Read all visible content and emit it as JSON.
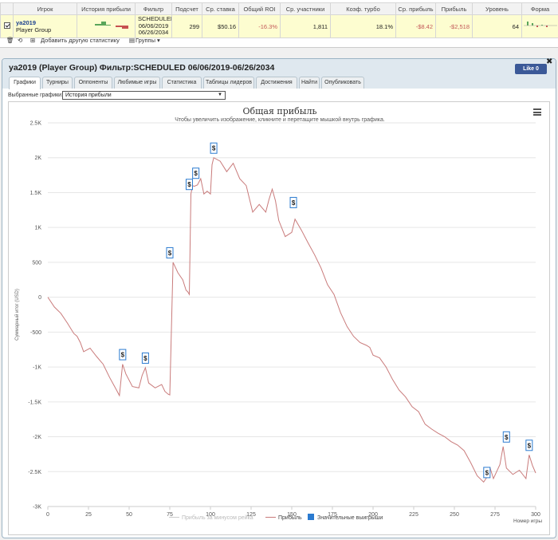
{
  "stats_table": {
    "headers": [
      "Игрок",
      "История прибыли",
      "Фильтр",
      "Подсчет",
      "Ср. ставка",
      "Общий ROI",
      "Ср. участники",
      "Коэф. турбо",
      "Ср. прибыль",
      "Прибыль",
      "Уровень",
      "Форма"
    ],
    "row": {
      "player_name": "ya2019",
      "player_group": "Player Group",
      "filter_lines": [
        "SCHEDULED",
        "06/06/2019",
        "06/26/2034"
      ],
      "count": "299",
      "avg_stake": "$50.16",
      "roi": "-16.3%",
      "avg_entrants": "1,811",
      "turbo": "18.1%",
      "avg_profit": "-$8.42",
      "profit": "-$2,518",
      "level": "64"
    }
  },
  "toolbar": {
    "add_stat": "Добавить другую статистику",
    "groups": "Группы"
  },
  "panel": {
    "title": "ya2019 (Player Group) Фильтр:SCHEDULED 06/06/2019-06/26/2034",
    "fb_like": "Like 0",
    "tabs": [
      "Графики",
      "Турниры",
      "Оппоненты",
      "Любимые игры",
      "Статистика",
      "Таблицы лидеров",
      "Достижения",
      "Найти",
      "Опубликовать"
    ],
    "chart_select_label": "Выбранные графики:",
    "chart_select_value": "История прибыли"
  },
  "chart_data": {
    "type": "line",
    "title": "Общая прибыль",
    "subtitle": "Чтобы увеличить изображение, кликните и перетащите мышкой внутрь графика.",
    "xlabel": "Номер игры",
    "ylabel": "Суммарный итог (USD)",
    "xlim": [
      0,
      300
    ],
    "ylim": [
      -3000,
      2500
    ],
    "x_ticks": [
      0,
      25,
      50,
      75,
      100,
      125,
      150,
      175,
      200,
      225,
      250,
      275,
      300
    ],
    "y_ticks": [
      2500,
      2000,
      1500,
      1000,
      500,
      0,
      -500,
      -1000,
      -1500,
      -2000,
      -2500,
      -3000
    ],
    "y_tick_labels": [
      "2.5K",
      "2K",
      "1.5K",
      "1K",
      "500",
      "0",
      "-500",
      "-1K",
      "-1.5K",
      "-2K",
      "-2.5K",
      "-3K"
    ],
    "x_tick_labels": [
      "0",
      "25",
      "50",
      "75",
      "100",
      "125",
      "150",
      "175",
      "200",
      "225",
      "250",
      "275",
      "300"
    ],
    "grid": true,
    "legend_position": "bottom",
    "colors": {
      "profit": "#c97b7b",
      "rake": "#cccccc",
      "wins": "#2b7bd0"
    },
    "series": [
      {
        "name": "Прибыль за минусом рейка",
        "color": "#cccccc",
        "x": [],
        "y": []
      },
      {
        "name": "Прибыль",
        "color": "#c97b7b",
        "x": [
          0,
          4,
          8,
          12,
          16,
          18,
          20,
          22,
          26,
          30,
          34,
          38,
          42,
          44,
          46,
          48,
          52,
          56,
          58,
          60,
          62,
          66,
          70,
          72,
          74,
          75,
          77,
          80,
          83,
          85,
          86,
          87,
          88,
          89,
          90,
          92,
          94,
          96,
          98,
          100,
          101,
          102,
          106,
          110,
          114,
          118,
          122,
          126,
          130,
          134,
          136,
          138,
          140,
          142,
          146,
          150,
          152,
          156,
          160,
          164,
          168,
          172,
          176,
          180,
          184,
          188,
          192,
          196,
          198,
          200,
          204,
          208,
          212,
          216,
          220,
          224,
          228,
          232,
          236,
          240,
          244,
          248,
          252,
          256,
          260,
          264,
          268,
          270,
          272,
          274,
          276,
          278,
          280,
          282,
          286,
          290,
          294,
          296,
          298,
          300
        ],
        "y": [
          0,
          -140,
          -230,
          -370,
          -520,
          -560,
          -650,
          -780,
          -730,
          -850,
          -960,
          -1150,
          -1320,
          -1410,
          -960,
          -1100,
          -1280,
          -1300,
          -1120,
          -1010,
          -1230,
          -1300,
          -1250,
          -1350,
          -1390,
          -1400,
          500,
          350,
          250,
          100,
          80,
          40,
          1480,
          1600,
          1590,
          1610,
          1700,
          1480,
          1520,
          1480,
          1900,
          2000,
          1950,
          1800,
          1920,
          1700,
          1600,
          1220,
          1330,
          1220,
          1400,
          1550,
          1380,
          1100,
          870,
          930,
          1120,
          960,
          780,
          610,
          420,
          180,
          40,
          -220,
          -420,
          -560,
          -650,
          -690,
          -720,
          -830,
          -870,
          -1000,
          -1180,
          -1330,
          -1430,
          -1570,
          -1640,
          -1820,
          -1890,
          -1950,
          -2000,
          -2070,
          -2120,
          -2200,
          -2370,
          -2560,
          -2650,
          -2580,
          -2450,
          -2600,
          -2500,
          -2400,
          -2140,
          -2450,
          -2540,
          -2480,
          -2600,
          -2260,
          -2410,
          -2520
        ]
      },
      {
        "name": "Значительные выигрыши",
        "color": "#2b7bd0",
        "x": [
          46,
          60,
          75,
          87,
          91,
          102,
          151,
          270,
          282,
          296
        ],
        "y": [
          -960,
          -1010,
          500,
          1480,
          1640,
          2000,
          1220,
          -2650,
          -2140,
          -2260
        ]
      }
    ],
    "marker_symbol": "$"
  }
}
